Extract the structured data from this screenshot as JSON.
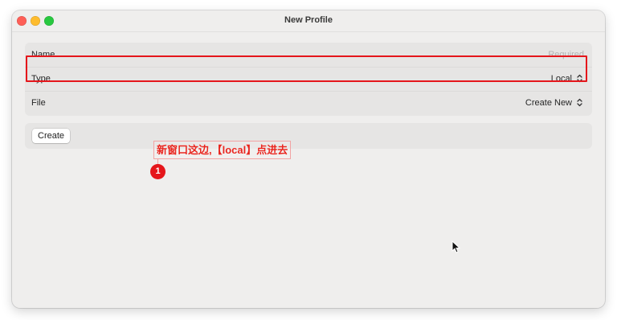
{
  "window": {
    "title": "New Profile"
  },
  "form": {
    "name": {
      "label": "Name",
      "placeholder": "Required"
    },
    "type": {
      "label": "Type",
      "value": "Local"
    },
    "file": {
      "label": "File",
      "value": "Create New"
    }
  },
  "actions": {
    "create_label": "Create"
  },
  "annotation": {
    "text": "新窗口这边,【local】点进去",
    "badge": "1",
    "color": "#e5161b"
  },
  "icons": {
    "updown": "chevron-up-down-icon",
    "cursor": "mouse-pointer-icon"
  }
}
